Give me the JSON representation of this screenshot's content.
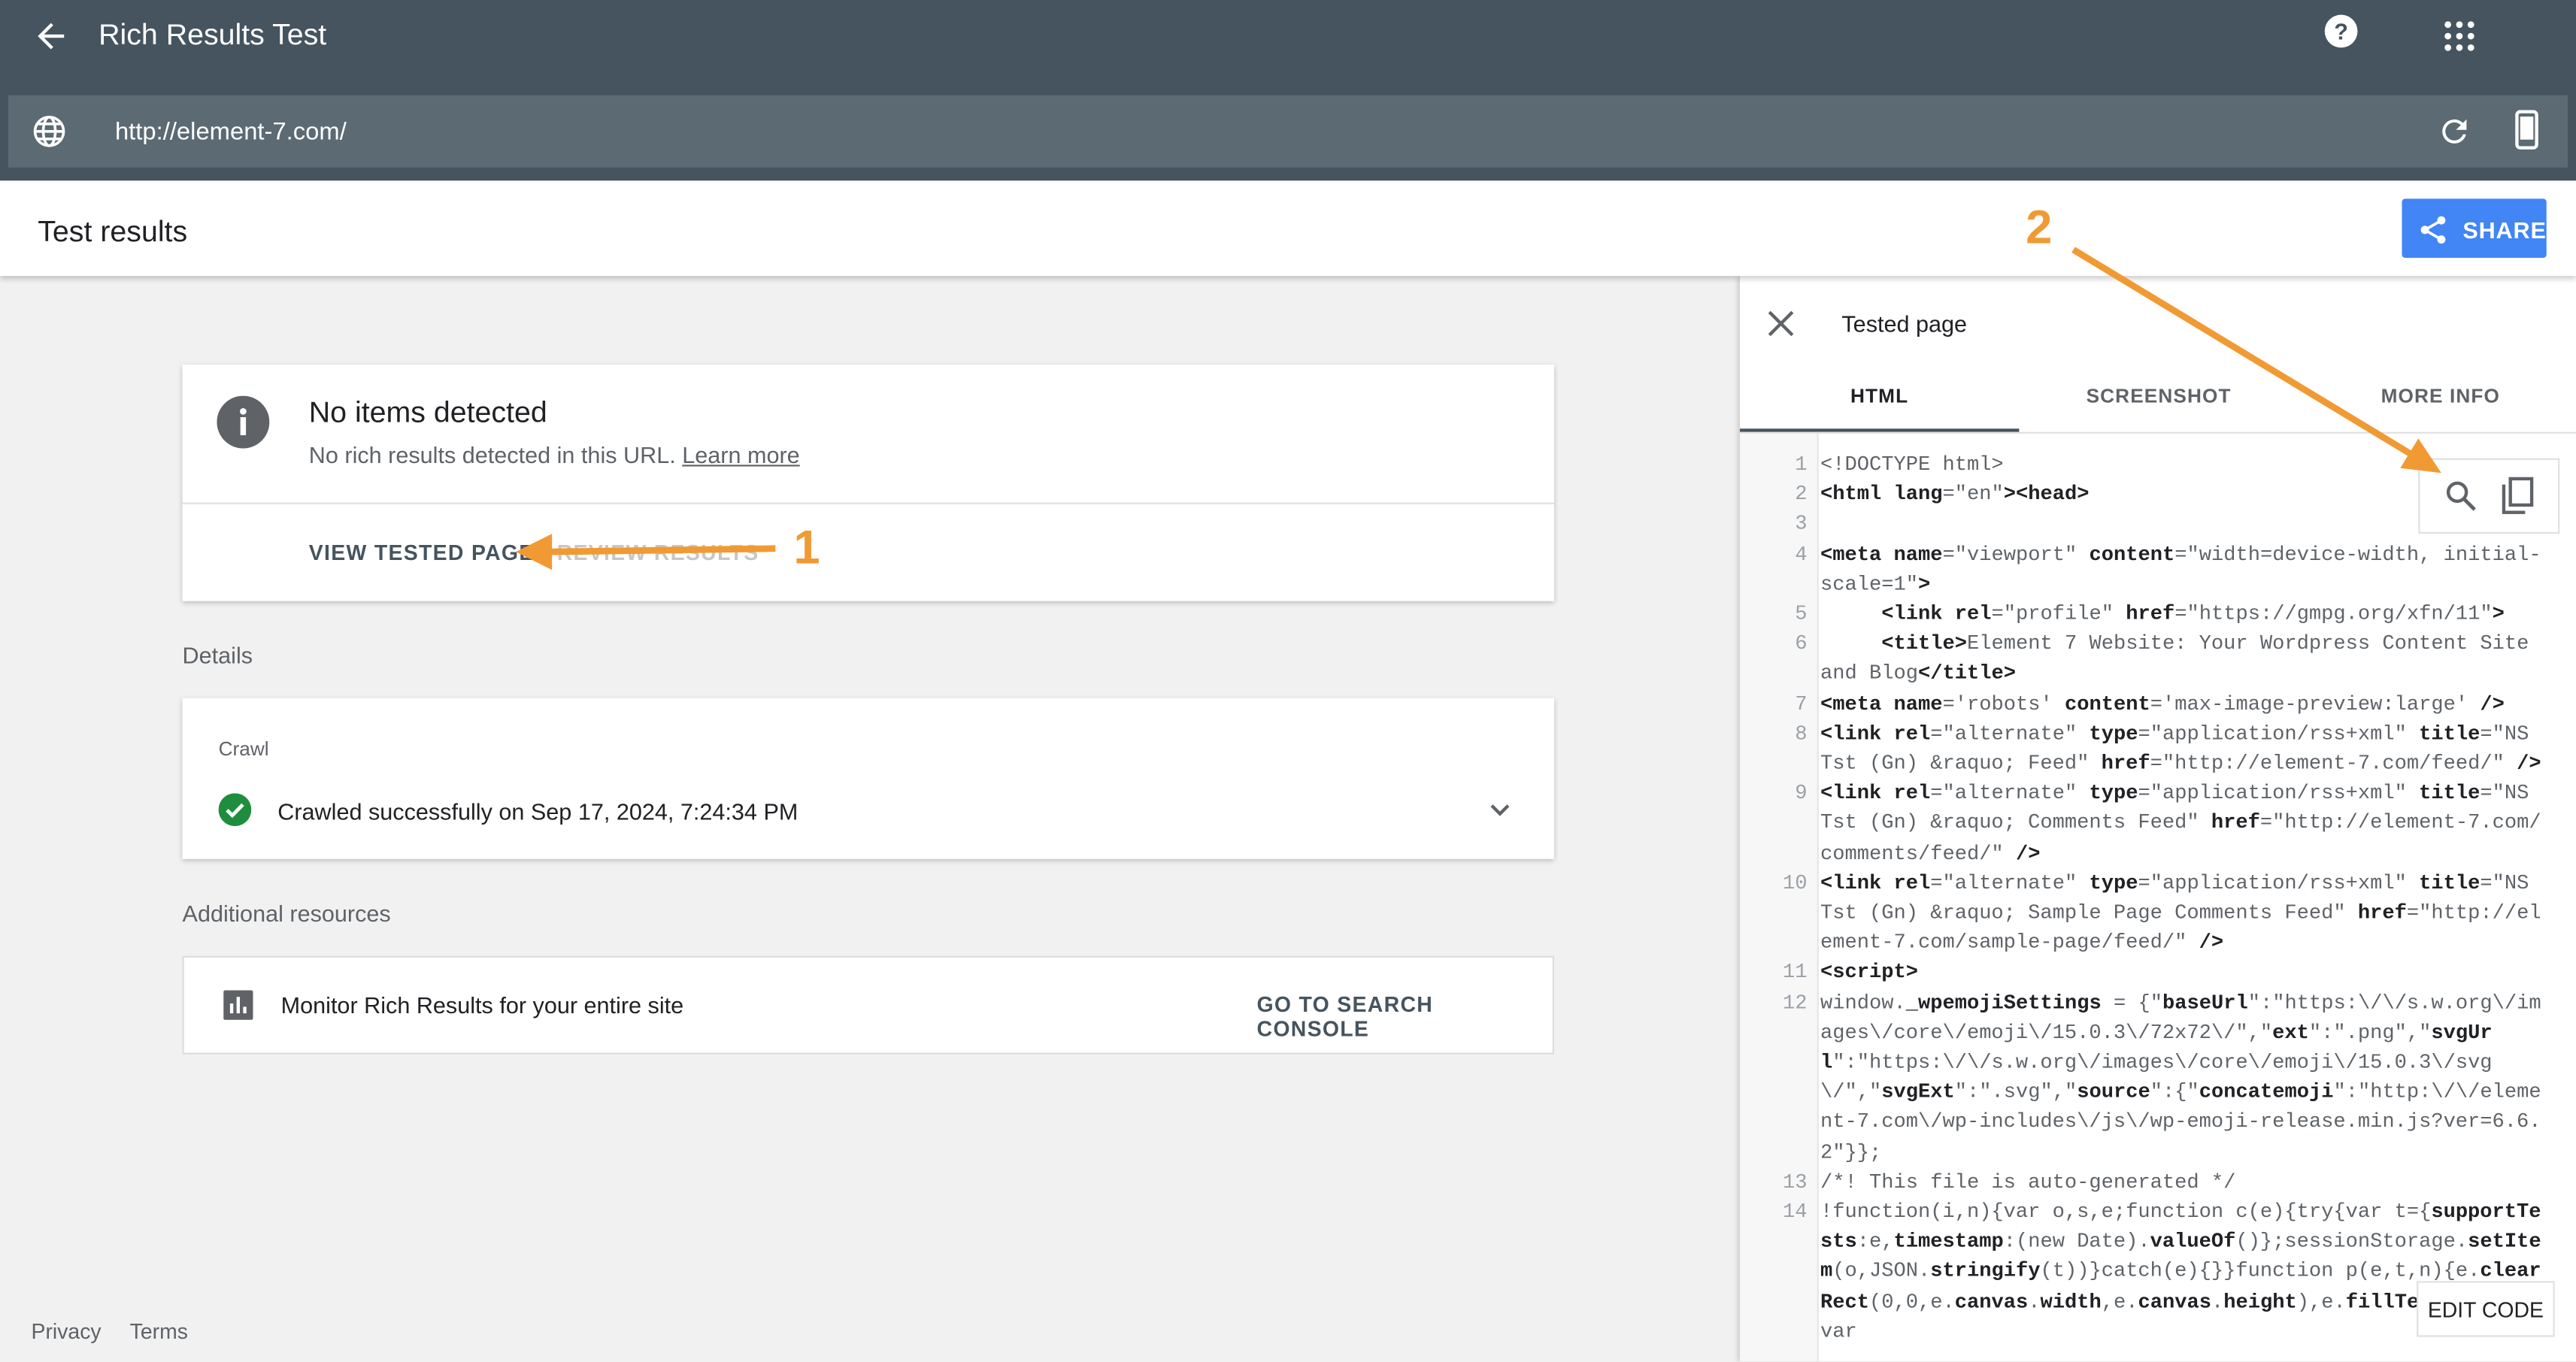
{
  "app": {
    "title": "Rich Results Test",
    "url": "http://element-7.com/"
  },
  "results_header": {
    "title": "Test results",
    "share_label": "SHARE"
  },
  "summary_card": {
    "title": "No items detected",
    "description": "No rich results detected in this URL.",
    "learn_more": "Learn more",
    "view_button": "VIEW TESTED PAGE",
    "review_button": "REVIEW RESULTS"
  },
  "details": {
    "label": "Details",
    "crawl_label": "Crawl",
    "crawl_status": "Crawled successfully on Sep 17, 2024, 7:24:34 PM"
  },
  "additional": {
    "label": "Additional resources",
    "monitor_text": "Monitor Rich Results for your entire site",
    "console_link": "GO TO SEARCH CONSOLE"
  },
  "footer": {
    "privacy": "Privacy",
    "terms": "Terms"
  },
  "panel": {
    "title": "Tested page",
    "tabs": [
      "HTML",
      "SCREENSHOT",
      "MORE INFO"
    ],
    "active_tab": "HTML",
    "edit_code": "EDIT CODE",
    "code_lines": [
      {
        "n": "1",
        "html": "&lt;!DOCTYPE html&gt;"
      },
      {
        "n": "2",
        "html": "<b>&lt;html</b> <b>lang</b>=\"en\"<b>&gt;&lt;head&gt;</b>"
      },
      {
        "n": "3",
        "html": ""
      },
      {
        "n": "4",
        "html": "<b>&lt;meta</b> <b>name</b>=\"viewport\" <b>content</b>=\"width=device-width, initial-scale=1\"<b>&gt;</b>"
      },
      {
        "n": "5",
        "html": "     <b>&lt;link</b> <b>rel</b>=\"profile\" <b>href</b>=\"https://gmpg.org/xfn/11\"<b>&gt;</b>"
      },
      {
        "n": "6",
        "html": "     <b>&lt;title&gt;</b>Element 7 Website: Your Wordpress Content Site and Blog<b>&lt;/title&gt;</b>"
      },
      {
        "n": "7",
        "html": "<b>&lt;meta</b> <b>name</b>='robots' <b>content</b>='max-image-preview:large' <b>/&gt;</b>"
      },
      {
        "n": "8",
        "html": "<b>&lt;link</b> <b>rel</b>=\"alternate\" <b>type</b>=\"application/rss+xml\" <b>title</b>=\"NS Tst (Gn) &amp;raquo; Feed\" <b>href</b>=\"http://element-7.com/feed/\" <b>/&gt;</b>"
      },
      {
        "n": "9",
        "html": "<b>&lt;link</b> <b>rel</b>=\"alternate\" <b>type</b>=\"application/rss+xml\" <b>title</b>=\"NS Tst (Gn) &amp;raquo; Comments Feed\" <b>href</b>=\"http://element-7.com/comments/feed/\" <b>/&gt;</b>"
      },
      {
        "n": "10",
        "html": "<b>&lt;link</b> <b>rel</b>=\"alternate\" <b>type</b>=\"application/rss+xml\" <b>title</b>=\"NS Tst (Gn) &amp;raquo; Sample Page Comments Feed\" <b>href</b>=\"http://element-7.com/sample-page/feed/\" <b>/&gt;</b>"
      },
      {
        "n": "11",
        "html": "<b>&lt;script&gt;</b>"
      },
      {
        "n": "12",
        "html": "window.<b>_wpemojiSettings</b> = {\"<b>baseUrl</b>\":\"https:\\/\\/s.w.org\\/images\\/core\\/emoji\\/15.0.3\\/72x72\\/\",\"<b>ext</b>\":\".png\",\"<b>svgUrl</b>\":\"https:\\/\\/s.w.org\\/images\\/core\\/emoji\\/15.0.3\\/svg\\/\",\"<b>svgExt</b>\":\".svg\",\"<b>source</b>\":{\"<b>concatemoji</b>\":\"http:\\/\\/element-7.com\\/wp-includes\\/js\\/wp-emoji-release.min.js?ver=6.6.2\"}};"
      },
      {
        "n": "13",
        "html": "/*! This file is auto-generated */"
      },
      {
        "n": "14",
        "html": "!function(i,n){var o,s,e;function c(e){try{var t={<b>supportTests</b>:e,<b>timestamp</b>:(new Date).<b>valueOf</b>()};sessionStorage.<b>setItem</b>(o,JSON.<b>stringify</b>(t))}catch(e){}}function p(e,t,n){e.<b>clearRect</b>(0,0,e.<b>canvas</b>.<b>width</b>,e.<b>canvas</b>.<b>height</b>),e.<b>fillText</b>(t,0,0);var"
      }
    ]
  },
  "annotations": {
    "marker_1": "1",
    "marker_2": "2",
    "color": "#f19a33"
  },
  "colors": {
    "topbar": "#45545e",
    "urlbar": "#5b6a73",
    "share": "#4285f4",
    "success": "#1e8e3e"
  }
}
